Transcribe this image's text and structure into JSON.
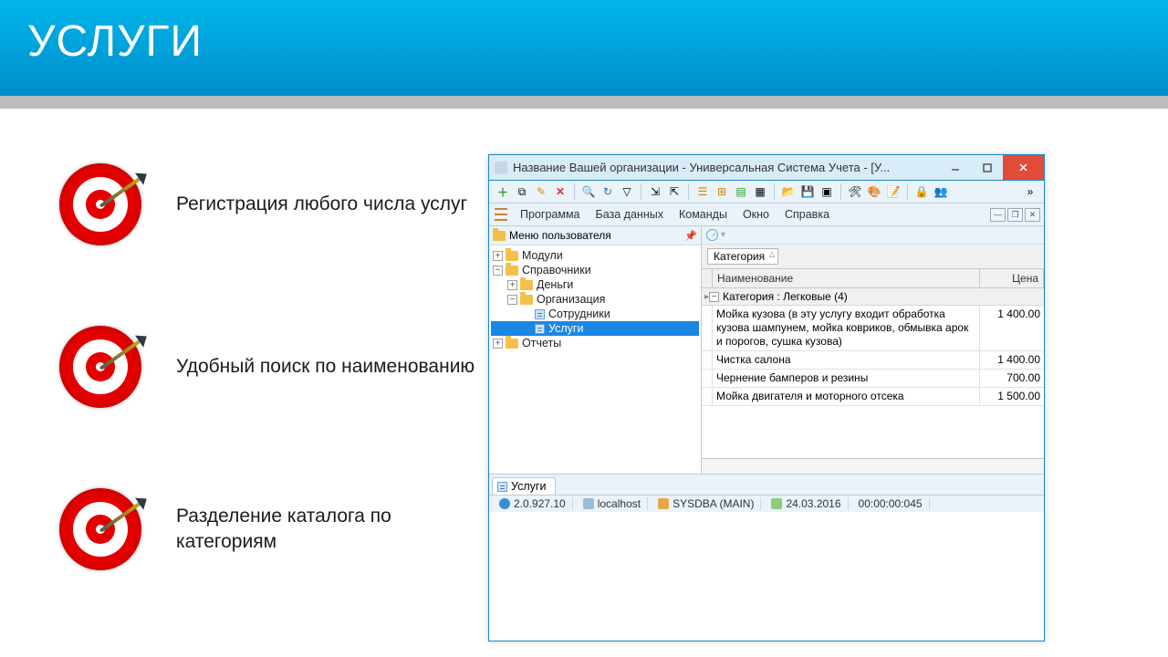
{
  "slide": {
    "title": "УСЛУГИ",
    "features": [
      "Регистрация любого числа услуг",
      "Удобный поиск по наименованию",
      "Разделение каталога по категориям"
    ]
  },
  "window": {
    "title": "Название Вашей организации - Универсальная Система Учета - [У...",
    "menu": [
      "Программа",
      "База данных",
      "Команды",
      "Окно",
      "Справка"
    ],
    "sidebar_title": "Меню пользователя",
    "tree": {
      "modules": "Модули",
      "dictionaries": "Справочники",
      "money": "Деньги",
      "organization": "Организация",
      "employees": "Сотрудники",
      "services": "Услуги",
      "reports": "Отчеты"
    },
    "group_column": "Категория",
    "grid_headers": {
      "name": "Наименование",
      "price": "Цена"
    },
    "group_row": "Категория : Легковые (4)",
    "rows": [
      {
        "name": "Мойка кузова (в эту услугу входит обработка кузова шампунем, мойка ковриков, обмывка арок и порогов, сушка кузова)",
        "price": "1 400.00"
      },
      {
        "name": "Чистка салона",
        "price": "1 400.00"
      },
      {
        "name": "Чернение бамперов и резины",
        "price": "700.00"
      },
      {
        "name": "Мойка двигателя и моторного отсека",
        "price": "1 500.00"
      }
    ],
    "tab": "Услуги",
    "status": {
      "version": "2.0.927.10",
      "host": "localhost",
      "user": "SYSDBA (MAIN)",
      "date": "24.03.2016",
      "elapsed": "00:00:00:045"
    }
  }
}
